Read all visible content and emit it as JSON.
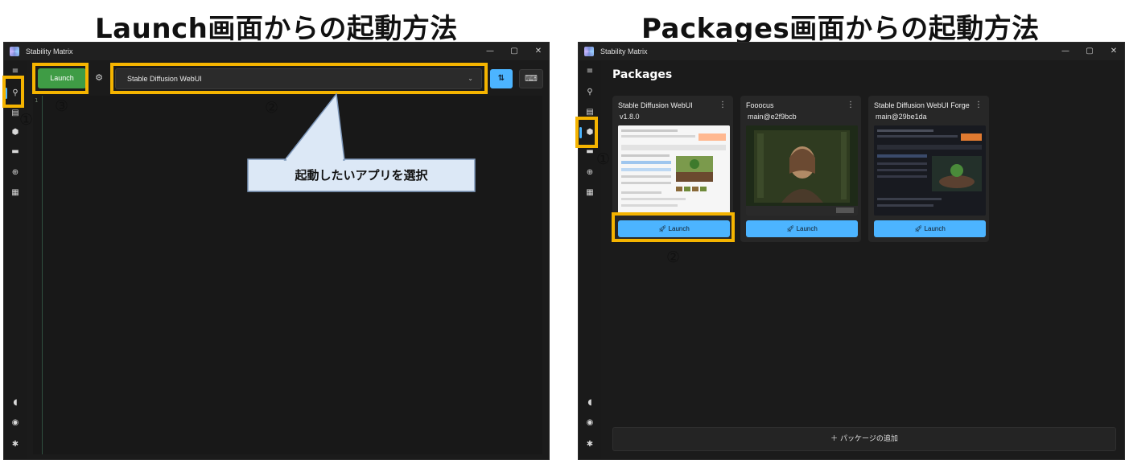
{
  "headings": {
    "left": "Launch画面からの起動方法",
    "right": "Packages画面からの起動方法"
  },
  "app": {
    "title": "Stability Matrix",
    "window_controls": {
      "minimize": "—",
      "maximize": "▢",
      "close": "✕"
    }
  },
  "sidebar_icons": {
    "menu": "≡",
    "launch": "⚲",
    "inference": "▤",
    "packages": "⬢",
    "checkpoints": "▬",
    "model_browser": "⊕",
    "extensions": "▦",
    "patreon": "◖",
    "discord": "◉",
    "settings": "✱"
  },
  "launch_page": {
    "launch_button": "Launch",
    "gear": "⚙",
    "selected_package": "Stable Diffusion WebUI",
    "chevron": "⌄",
    "sort_icon": "⇅",
    "keyboard_icon": "⌨",
    "console_line": "1"
  },
  "packages_page": {
    "title": "Packages",
    "cards": [
      {
        "name": "Stable Diffusion WebUI",
        "version": "v1.8.0",
        "launch": "Launch",
        "menu": "⋮"
      },
      {
        "name": "Fooocus",
        "version": "main@e2f9bcb",
        "launch": "Launch",
        "menu": "⋮"
      },
      {
        "name": "Stable Diffusion WebUI Forge",
        "version": "main@29be1da",
        "launch": "Launch",
        "menu": "⋮"
      }
    ],
    "add_package": "＋ パッケージの追加"
  },
  "annotations": {
    "left": {
      "n1": "①",
      "n2": "②",
      "n3": "③",
      "callout": "起動したいアプリを選択"
    },
    "right": {
      "n1": "①",
      "n2": "②"
    }
  },
  "colors": {
    "highlight": "#f5b400",
    "accent_blue": "#4cb4ff",
    "launch_green": "#3f9c45",
    "callout_fill": "#dce8f6",
    "callout_border": "#7f99bc"
  }
}
